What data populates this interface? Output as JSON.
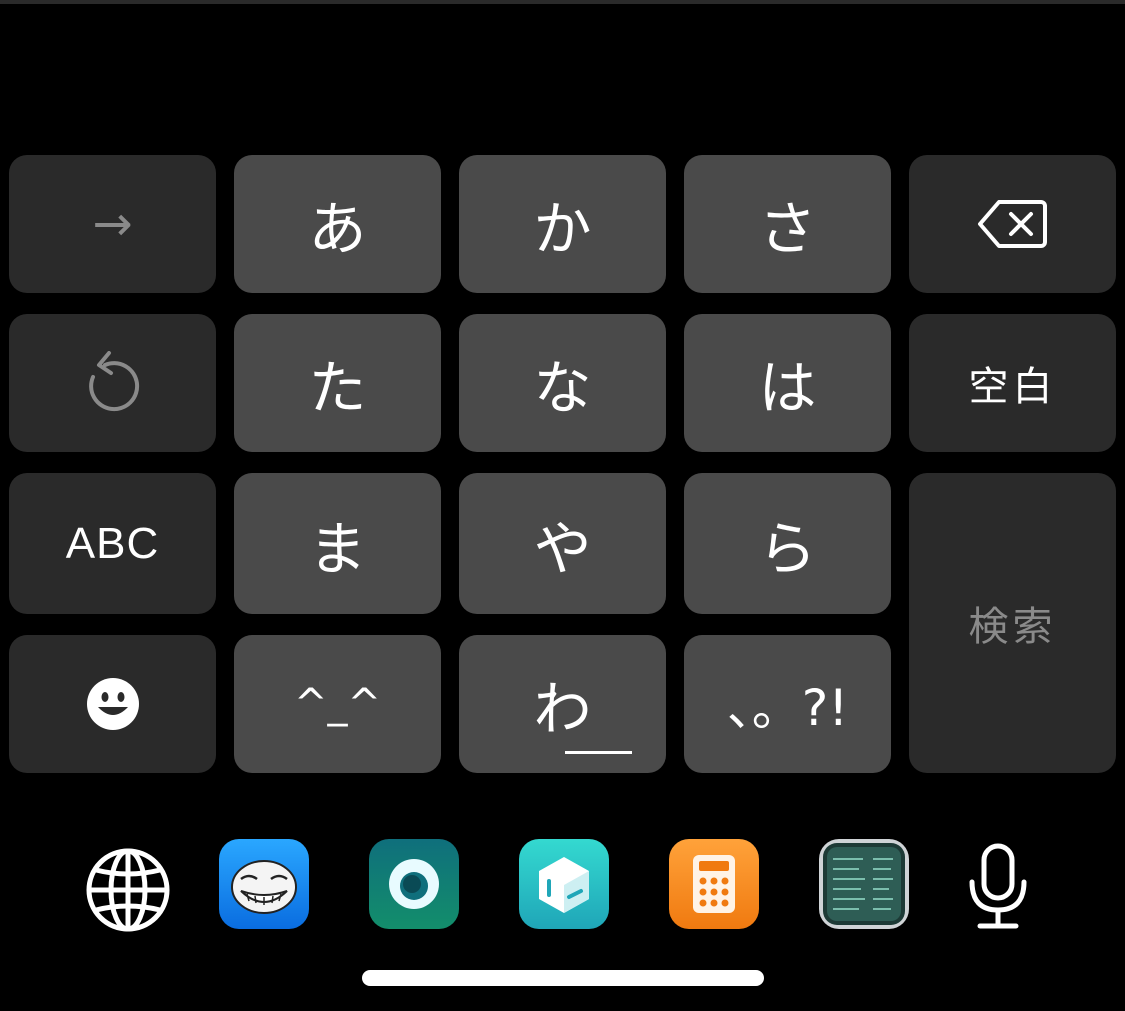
{
  "keyboard": {
    "rows": [
      [
        {
          "name": "next-key",
          "label": "→"
        },
        {
          "name": "key-a",
          "label": "あ"
        },
        {
          "name": "key-ka",
          "label": "か"
        },
        {
          "name": "key-sa",
          "label": "さ"
        },
        {
          "name": "delete-key",
          "label": ""
        }
      ],
      [
        {
          "name": "undo-key",
          "label": ""
        },
        {
          "name": "key-ta",
          "label": "た"
        },
        {
          "name": "key-na",
          "label": "な"
        },
        {
          "name": "key-ha",
          "label": "は"
        },
        {
          "name": "space-key",
          "label": "空白"
        }
      ],
      [
        {
          "name": "abc-key",
          "label": "ABC"
        },
        {
          "name": "key-ma",
          "label": "ま"
        },
        {
          "name": "key-ya",
          "label": "や"
        },
        {
          "name": "key-ra",
          "label": "ら"
        },
        {
          "name": "search-key",
          "label": "検索"
        }
      ],
      [
        {
          "name": "emoji-key",
          "label": ""
        },
        {
          "name": "kaomoji-key",
          "label": "^_^"
        },
        {
          "name": "key-wa",
          "label": "わ"
        },
        {
          "name": "punctuation-key",
          "label": "、。?!"
        }
      ]
    ]
  },
  "dock": {
    "icons": [
      "globe-icon",
      "trollface-app-icon",
      "circle-app-icon",
      "cube-app-icon",
      "calculator-app-icon",
      "terminal-app-icon",
      "microphone-icon"
    ]
  },
  "colors": {
    "key_light": "#4a4a4a",
    "key_dark": "#2a2a2a",
    "background": "#000000"
  }
}
